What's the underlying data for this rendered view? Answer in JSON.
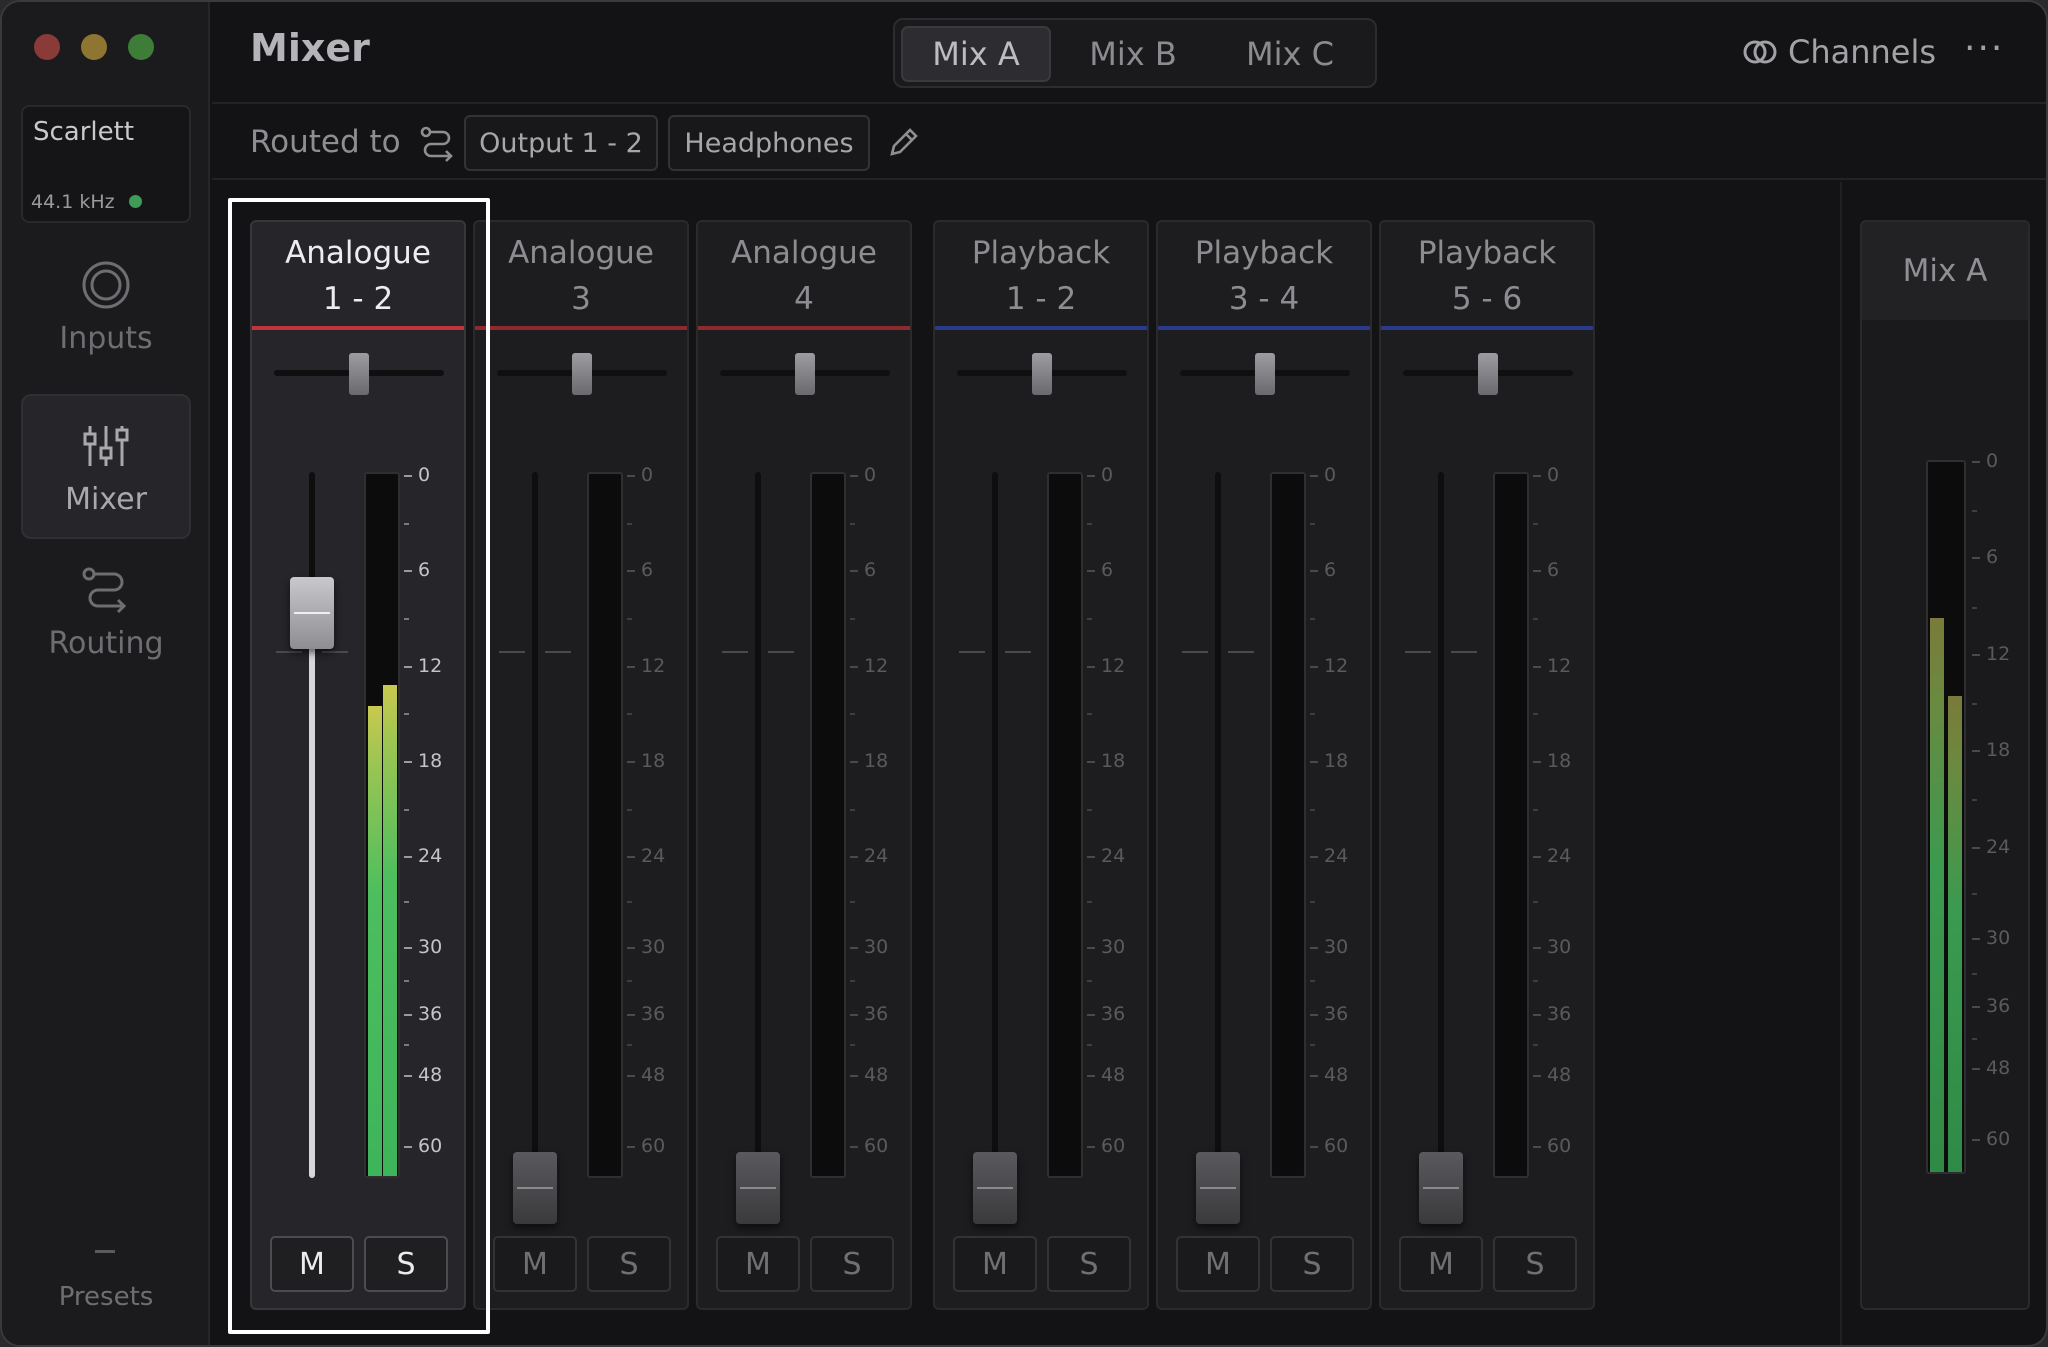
{
  "sidebar": {
    "device": {
      "name": "Scarlett",
      "sample_rate": "44.1 kHz",
      "status_color": "#3f9c57"
    },
    "nav": [
      {
        "label": "Inputs",
        "icon": "inputs-icon"
      },
      {
        "label": "Mixer",
        "icon": "mixer-sliders-icon",
        "active": true
      },
      {
        "label": "Routing",
        "icon": "routing-icon"
      }
    ],
    "presets_label": "Presets"
  },
  "header": {
    "title": "Mixer",
    "tabs": [
      {
        "label": "Mix A",
        "active": true
      },
      {
        "label": "Mix B"
      },
      {
        "label": "Mix C"
      }
    ],
    "channels_label": "Channels",
    "more_label": "···"
  },
  "routing": {
    "label": "Routed to",
    "outputs": [
      "Output 1 - 2",
      "Headphones"
    ]
  },
  "meter_scale": [
    "0",
    "6",
    "12",
    "18",
    "24",
    "30",
    "36",
    "48",
    "60"
  ],
  "strips": [
    {
      "name_line1": "Analogue",
      "name_line2": "1 - 2",
      "accent": "#c0353a",
      "selected": true,
      "fader_level": 0.2,
      "pan": 0.0,
      "meter_l": 0.67,
      "meter_r": 0.7,
      "mute": "M",
      "solo": "S"
    },
    {
      "name_line1": "Analogue",
      "name_line2": "3",
      "accent": "#8c2a2e",
      "fader_level": 1.0,
      "pan": 0.0,
      "meter_l": 0,
      "meter_r": 0,
      "mute": "M",
      "solo": "S"
    },
    {
      "name_line1": "Analogue",
      "name_line2": "4",
      "accent": "#8c2a2e",
      "fader_level": 1.0,
      "pan": 0.0,
      "meter_l": 0,
      "meter_r": 0,
      "mute": "M",
      "solo": "S"
    },
    {
      "name_line1": "Playback",
      "name_line2": "1 - 2",
      "accent": "#2a3a8c",
      "fader_level": 1.0,
      "pan": 0.0,
      "meter_l": 0,
      "meter_r": 0,
      "mute": "M",
      "solo": "S"
    },
    {
      "name_line1": "Playback",
      "name_line2": "3 - 4",
      "accent": "#2a3a8c",
      "fader_level": 1.0,
      "pan": 0.0,
      "meter_l": 0,
      "meter_r": 0,
      "mute": "M",
      "solo": "S"
    },
    {
      "name_line1": "Playback",
      "name_line2": "5 - 6",
      "accent": "#2a3a8c",
      "fader_level": 1.0,
      "pan": 0.0,
      "meter_l": 0,
      "meter_r": 0,
      "mute": "M",
      "solo": "S"
    }
  ],
  "mix_strip": {
    "name": "Mix A",
    "meter_l": 0.78,
    "meter_r": 0.67
  }
}
